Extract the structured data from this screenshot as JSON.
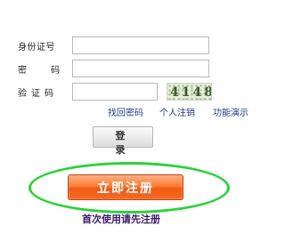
{
  "form": {
    "id_label": "身份证号",
    "id_value": "",
    "password_label": "密 码",
    "password_value": "",
    "captcha_label": "验证码",
    "captcha_value": "",
    "captcha_image_text": "4148"
  },
  "links": {
    "recover_password": "找回密码",
    "personal_deregister": "个人注销",
    "feature_demo": "功能演示"
  },
  "buttons": {
    "login": "登 录",
    "register": "立即注册"
  },
  "hint": "首次使用请先注册",
  "colors": {
    "register_button": "#f46a20",
    "highlight_ring": "#2bd23a",
    "link": "#1d3d8f",
    "hint": "#3a1a6e"
  }
}
